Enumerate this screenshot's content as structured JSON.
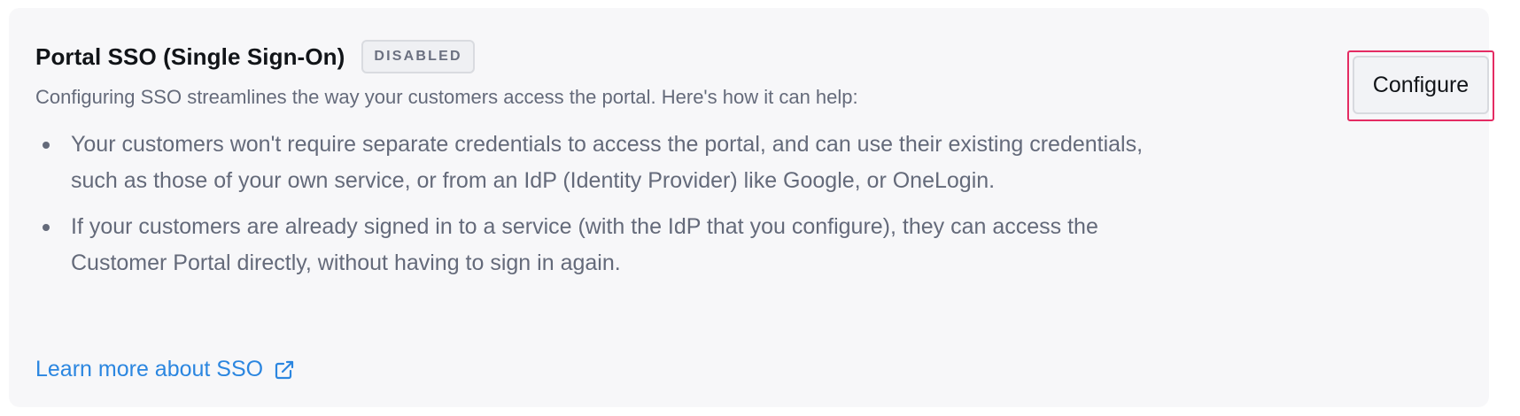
{
  "sso": {
    "title": "Portal SSO (Single Sign-On)",
    "status_badge": "DISABLED",
    "intro": "Configuring SSO streamlines the way your customers access the portal. Here's how it can help:",
    "bullets": [
      "Your customers won't require separate credentials to access the portal, and can use their existing credentials, such as those of your own service, or from an IdP (Identity Provider) like Google, or OneLogin.",
      "If your customers are already signed in to a service (with the IdP that you configure), they can access the Customer Portal directly, without having to sign in again."
    ],
    "learn_more": "Learn more about SSO",
    "learn_more_icon": "external-link-icon",
    "configure_label": "Configure"
  },
  "colors": {
    "card_background": "#f7f7f9",
    "link": "#2b86e0",
    "highlight": "#e42c63",
    "body_text": "#646a7a"
  }
}
